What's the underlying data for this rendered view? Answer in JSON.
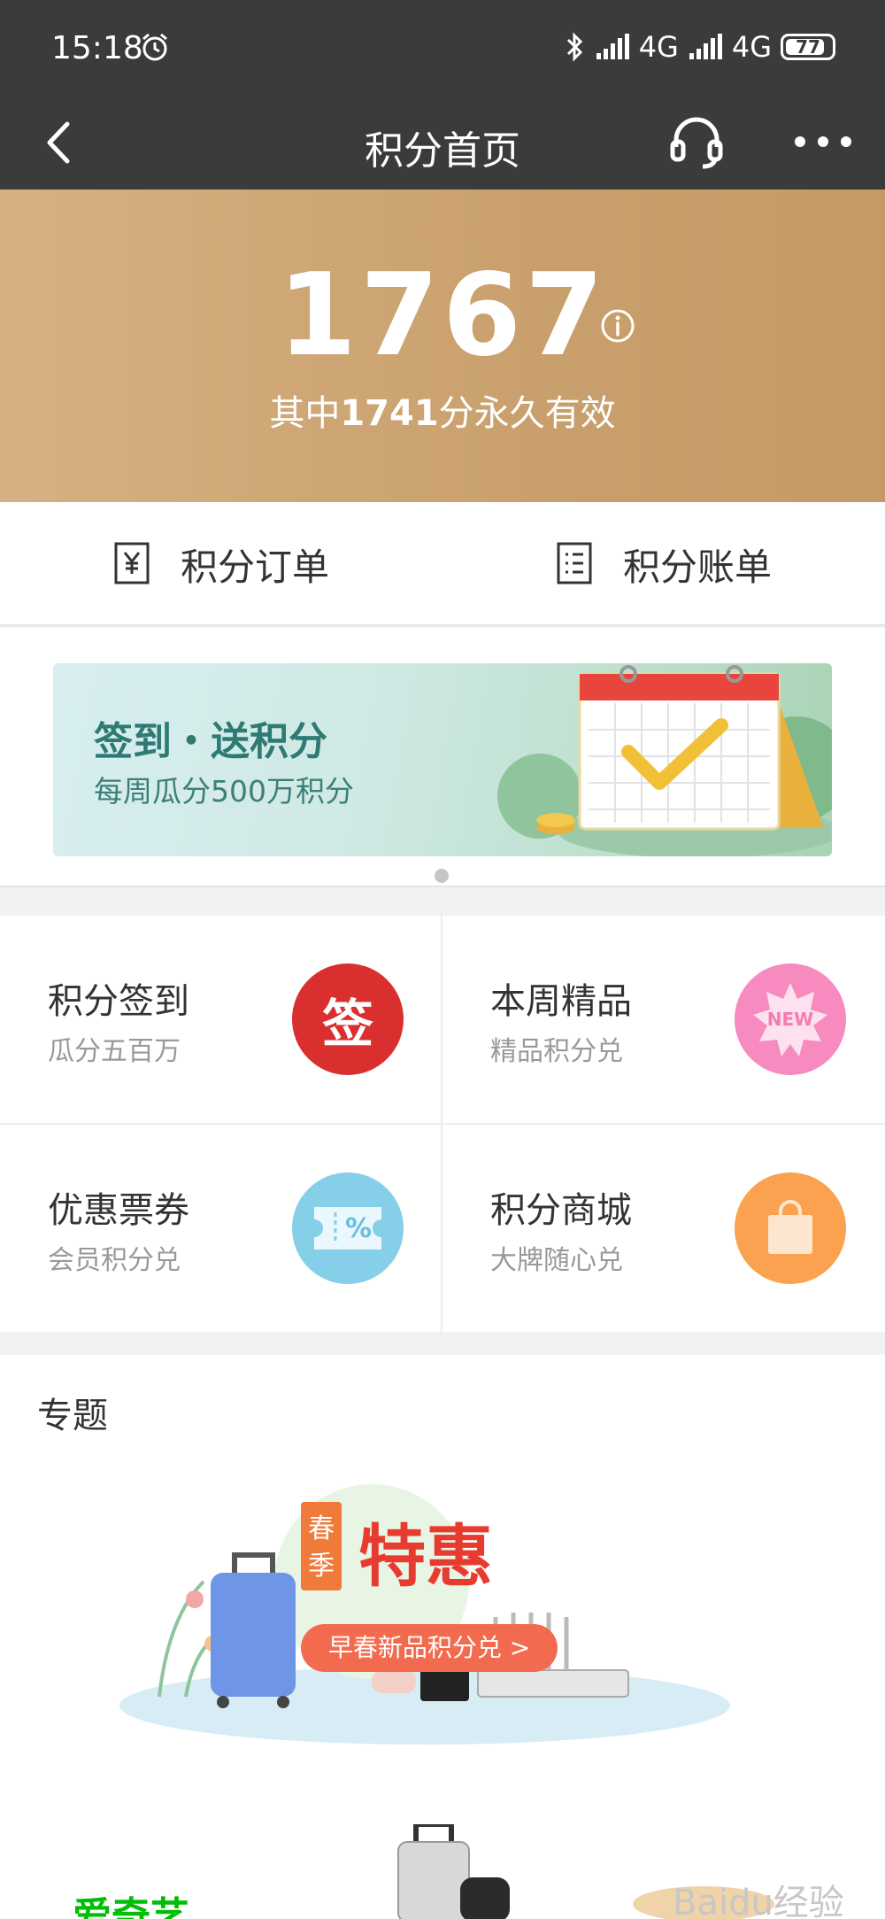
{
  "status_bar": {
    "time": "15:18",
    "network_1": "4G",
    "network_2": "4G",
    "battery": "77"
  },
  "nav": {
    "title": "积分首页"
  },
  "points": {
    "value": "1767",
    "permanent_prefix": "其中",
    "permanent_value": "1741",
    "permanent_suffix": "分永久有效"
  },
  "shortcuts": {
    "orders_label": "积分订单",
    "bill_label": "积分账单"
  },
  "banner": {
    "title": "签到・送积分",
    "subtitle": "每周瓜分500万积分"
  },
  "features": [
    {
      "title": "积分签到",
      "subtitle": "瓜分五百万",
      "icon": "sign-in-icon",
      "icon_text": "签",
      "color": "#d9302f"
    },
    {
      "title": "本周精品",
      "subtitle": "精品积分兑",
      "icon": "new-badge-icon",
      "icon_text": "NEW",
      "color": "#f78bbf"
    },
    {
      "title": "优惠票券",
      "subtitle": "会员积分兑",
      "icon": "coupon-icon",
      "icon_text": "%",
      "color": "#86cfe9"
    },
    {
      "title": "积分商城",
      "subtitle": "大牌随心兑",
      "icon": "shopping-bag-icon",
      "icon_text": "",
      "color": "#fba250"
    }
  ],
  "topic": {
    "section_title": "专题",
    "promo_season": "春季",
    "promo_title": "特惠",
    "promo_cta": "早春新品积分兑 >",
    "brand_logo": "爱奇艺",
    "watermark": "Baidu经验"
  },
  "colors": {
    "header_bar": "#3b3b3b",
    "gold": "#c9a06d",
    "accent_red": "#e8453c"
  }
}
